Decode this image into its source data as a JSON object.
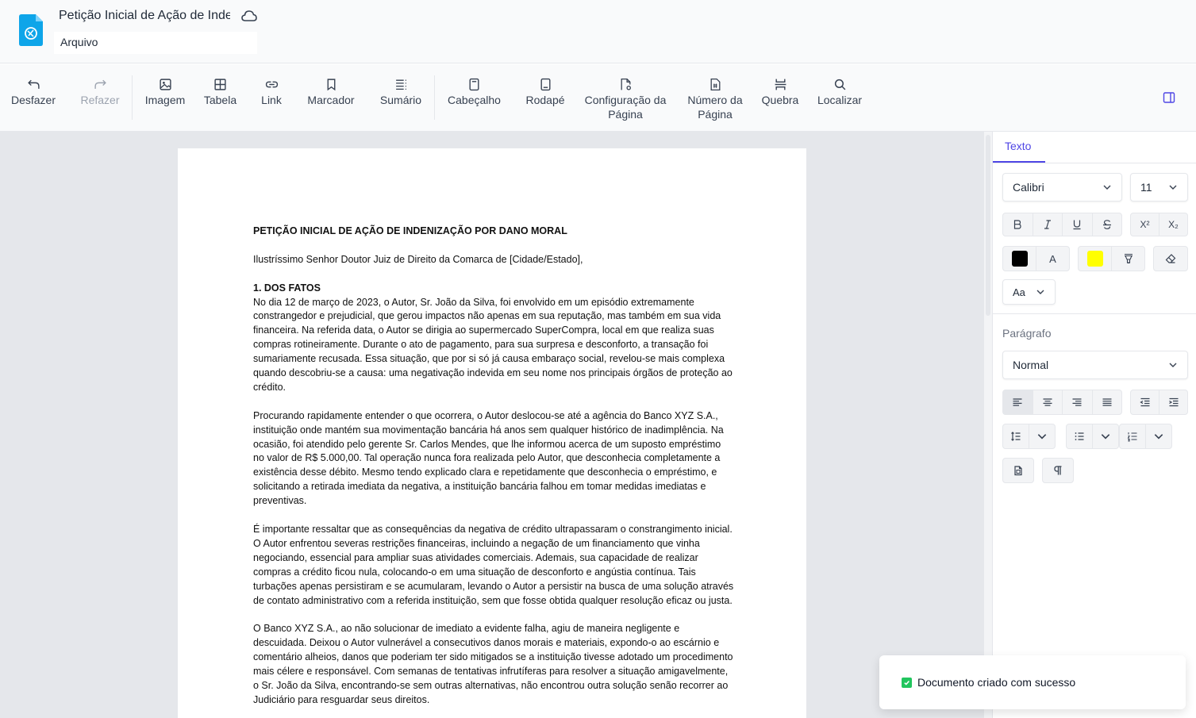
{
  "header": {
    "doc_title": "Petição Inicial de Ação de Indenização",
    "menu_file": "Arquivo"
  },
  "toolbar": {
    "undo": "Desfazer",
    "redo": "Refazer",
    "image": "Imagem",
    "table": "Tabela",
    "link": "Link",
    "bookmark": "Marcador",
    "toc": "Sumário",
    "header": "Cabeçalho",
    "footer": "Rodapé",
    "page_setup_1": "Configuração da",
    "page_setup_2": "Página",
    "page_number_1": "Número da",
    "page_number_2": "Página",
    "break": "Quebra",
    "find": "Localizar"
  },
  "document": {
    "title": "PETIÇÃO INICIAL DE AÇÃO DE INDENIZAÇÃO POR DANO MORAL",
    "salutation": "Ilustríssimo Senhor Doutor Juiz de Direito da Comarca de [Cidade/Estado],",
    "section1_heading": "1. DOS FATOS",
    "p1": "No dia 12 de março de 2023, o Autor, Sr. João da Silva, foi envolvido em um episódio extremamente constrangedor e prejudicial, que gerou impactos não apenas em sua reputação, mas também em sua vida financeira. Na referida data, o Autor se dirigia ao supermercado SuperCompra, local em que realiza suas compras rotineiramente. Durante o ato de pagamento, para sua surpresa e desconforto, a transação foi sumariamente recusada. Essa situação, que por si só já causa embaraço social, revelou-se mais complexa quando descobriu-se a causa: uma negativação indevida em seu nome nos principais órgãos de proteção ao crédito.",
    "p2": "Procurando rapidamente entender o que ocorrera, o Autor deslocou-se até a agência do Banco XYZ S.A., instituição onde mantém sua movimentação bancária há anos sem qualquer histórico de inadimplência. Na ocasião, foi atendido pelo gerente Sr. Carlos Mendes, que lhe informou acerca de um suposto empréstimo no valor de R$ 5.000,00. Tal operação nunca fora realizada pelo Autor, que desconhecia completamente a existência desse débito. Mesmo tendo explicado clara e repetidamente que desconhecia o empréstimo, e solicitando a retirada imediata da negativa, a instituição bancária falhou em tomar medidas imediatas e preventivas.",
    "p3": "É importante ressaltar que as consequências da negativa de crédito ultrapassaram o constrangimento inicial. O Autor enfrentou severas restrições financeiras, incluindo a negação de um financiamento que vinha negociando, essencial para ampliar suas atividades comerciais. Ademais, sua capacidade de realizar compras a crédito ficou nula, colocando-o em uma situação de desconforto e angústia contínua. Tais turbações apenas persistiram e se acumularam, levando o Autor a persistir na busca de uma solução através de contato administrativo com a referida instituição, sem que fosse obtida qualquer resolução eficaz ou justa.",
    "p4": "O Banco XYZ S.A., ao não solucionar de imediato a evidente falha, agiu de maneira negligente e descuidada. Deixou o Autor vulnerável a consecutivos danos morais e materiais, expondo-o ao escárnio e comentário alheios, danos que poderiam ter sido mitigados se a instituição tivesse adotado um procedimento mais célere e responsável. Com semanas de tentativas infrutíferas para resolver a situação amigavelmente, o Sr. João da Silva, encontrando-se sem outras alternativas, não encontrou outra solução senão recorrer ao Judiciário para resguardar seus direitos."
  },
  "panel": {
    "tab_text": "Texto",
    "font_family": "Calibri",
    "font_size": "11",
    "superscript": "X²",
    "subscript": "X₂",
    "font_color_label": "A",
    "text_color": "#000000",
    "highlight_color": "#ffff00",
    "case_label": "Aa",
    "paragraph_label": "Parágrafo",
    "paragraph_style": "Normal"
  },
  "toast": {
    "message": "Documento criado com sucesso"
  }
}
